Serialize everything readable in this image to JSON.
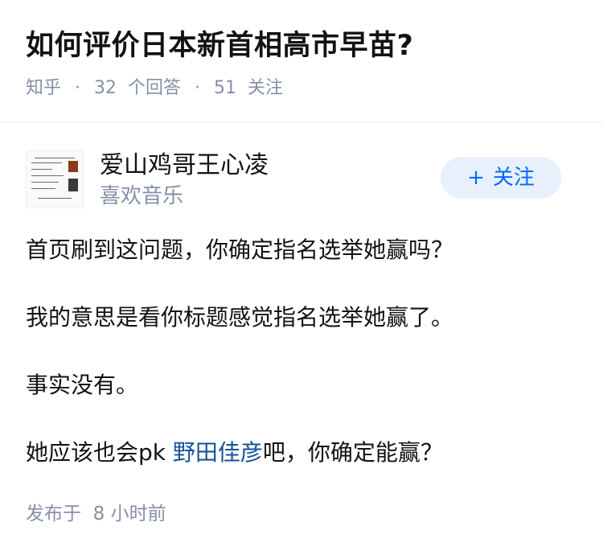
{
  "question": {
    "title": "如何评价日本新首相高市早苗?",
    "source": "知乎",
    "answers_count": "32",
    "answers_label": "个回答",
    "followers_count": "51",
    "followers_label": "关注"
  },
  "author": {
    "name": "爱山鸡哥王心凌",
    "bio": "喜欢音乐",
    "follow_label": "关注",
    "follow_icon": "plus-icon"
  },
  "answer": {
    "p1": "首页刷到这问题，你确定指名选举她赢吗？",
    "p2": "我的意思是看你标题感觉指名选举她赢了。",
    "p3": "事实没有。",
    "p4_before": "她应该也会pk ",
    "p4_link": "野田佳彦",
    "p4_after": "吧，你确定能赢？"
  },
  "meta": {
    "published_label": "发布于",
    "published_time": "8 小时前"
  },
  "colors": {
    "accent": "#0066ff",
    "link": "#175199",
    "meta_gray": "#8590a6",
    "follow_bg": "#e8f0fb"
  }
}
